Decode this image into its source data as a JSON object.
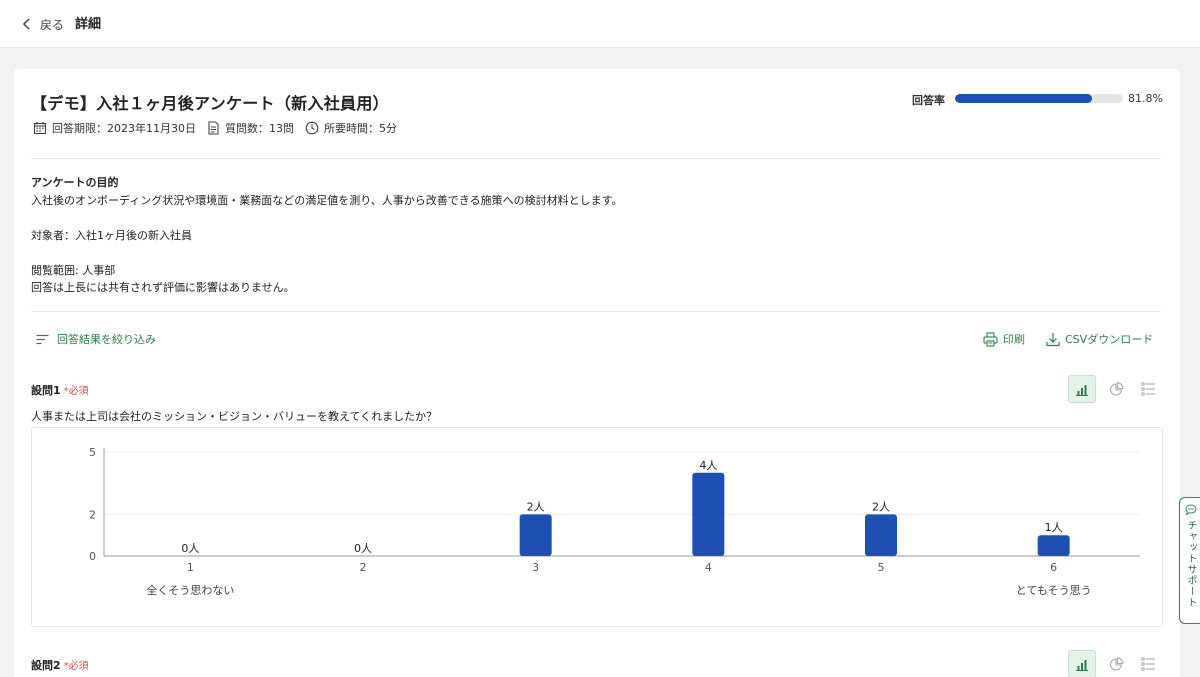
{
  "header": {
    "back_label": "戻る",
    "title": "詳細"
  },
  "survey": {
    "title": "【デモ】入社１ヶ月後アンケート（新入社員用）",
    "deadline": "回答期限：2023年11月30日",
    "question_count": "質問数：13問",
    "duration": "所要時間：5分"
  },
  "response_rate": {
    "label": "回答率",
    "value_text": "81.8%",
    "fraction": 0.818,
    "fill_color": "#1e4fb3"
  },
  "purpose": {
    "heading": "アンケートの目的",
    "line1": "入社後のオンボーディング状況や環境面・業務面などの満足値を測り、人事から改善できる施策への検討材料とします。",
    "line2": "対象者：入社1ヶ月後の新入社員",
    "line3": "閲覧範囲: 人事部",
    "line4": "回答は上長には共有されず評価に影響はありません。"
  },
  "toolbar": {
    "filter_label": "回答結果を絞り込み",
    "print_label": "印刷",
    "csv_label": "CSVダウンロード"
  },
  "questions": [
    {
      "label": "設問1",
      "required": "*必須",
      "text": "人事または上司は会社のミッション・ビジョン・バリューを教えてくれましたか？"
    },
    {
      "label": "設問2",
      "required": "*必須"
    }
  ],
  "view_icons": [
    "bar-chart-icon",
    "pie-chart-icon",
    "list-icon"
  ],
  "chat": {
    "label": "チャットサポート"
  },
  "chart_data": {
    "type": "bar",
    "categories": [
      "1",
      "2",
      "3",
      "4",
      "5",
      "6"
    ],
    "values": [
      0,
      0,
      2,
      4,
      2,
      1
    ],
    "value_labels": [
      "0人",
      "0人",
      "2人",
      "4人",
      "2人",
      "1人"
    ],
    "yticks": [
      0,
      2,
      5
    ],
    "ylim": [
      0,
      5
    ],
    "scale_min_label": "全くそう思わない",
    "scale_max_label": "とてもそう思う",
    "bar_color": "#1e4fb3"
  }
}
